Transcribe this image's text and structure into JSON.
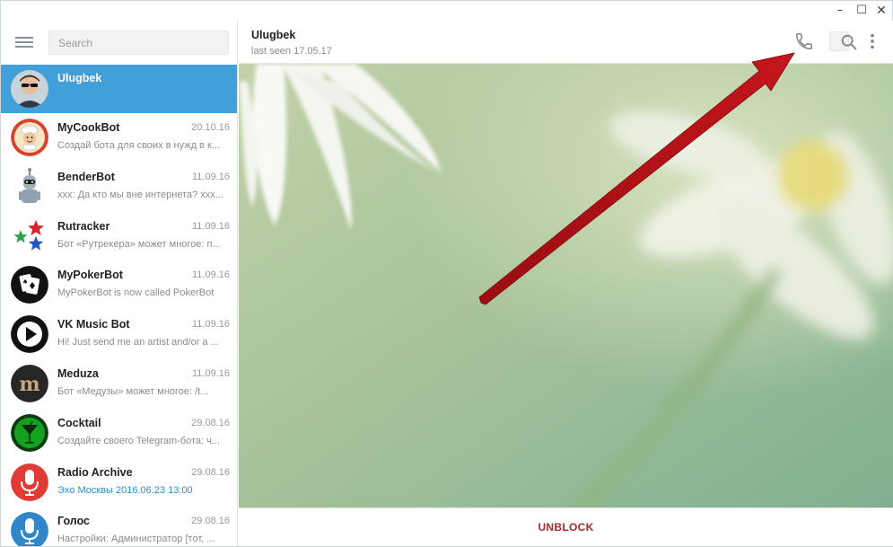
{
  "window": {
    "controls": {
      "minimize": "–",
      "maximize": "☐",
      "close": "✕"
    }
  },
  "sidebar": {
    "menu_icon": "hamburger-menu-icon",
    "search_placeholder": "Search",
    "chats": [
      {
        "name": "Ulugbek",
        "date": "",
        "preview": "",
        "active": true,
        "avatar": "user-photo"
      },
      {
        "name": "MyCookBot",
        "date": "20.10.16",
        "preview": "Создай бота для своих в нужд в к...",
        "avatar": "cook-bot-logo"
      },
      {
        "name": "BenderBot",
        "date": "11.09.16",
        "preview": "xxx: Да кто мы вне интернета? xxx...",
        "avatar": "bender-robot-logo"
      },
      {
        "name": "Rutracker",
        "date": "11.09.16",
        "preview": "Бот «Рутрекера» может многое: п...",
        "avatar": "rutracker-stars-logo"
      },
      {
        "name": "MyPokerBot",
        "date": "11.09.16",
        "preview": "MyPokerBot is now called PokerBot",
        "avatar": "poker-cards-logo"
      },
      {
        "name": "VK Music Bot",
        "date": "11.09.16",
        "preview": "Hi! Just send me an artist and/or a ...",
        "avatar": "play-button-logo"
      },
      {
        "name": "Meduza",
        "date": "11.09.16",
        "preview": "Бот «Медузы» может многое:  /t...",
        "avatar": "meduza-m-logo"
      },
      {
        "name": "Cocktail",
        "date": "29.08.16",
        "preview": "Создайте своего Telegram-бота: ч...",
        "avatar": "cocktail-glass-logo"
      },
      {
        "name": "Radio Archive",
        "date": "29.08.16",
        "preview": "Эхо Москвы 2016.06.23 13:00",
        "accent": true,
        "avatar": "microphone-logo"
      },
      {
        "name": "Голос",
        "date": "29.08.16",
        "preview": "Настройки: Администратор [тот, ...",
        "avatar": "microphone-blue-logo"
      }
    ]
  },
  "header": {
    "peer_name": "Ulugbek",
    "peer_status": "last seen 17.05.17",
    "icons": [
      "phone-call-icon",
      "search-icon",
      "more-vertical-icon"
    ]
  },
  "chat_area": {
    "background": "daisy-flowers-wallpaper",
    "annotation": "red-arrow-pointing-to-call-icon"
  },
  "bottom_bar": {
    "unblock_label": "UNBLOCK"
  },
  "colors": {
    "accent": "#419fd9",
    "unblock": "#a52a2a",
    "arrow": "#b11217",
    "preview_accent": "#2a8fcf"
  }
}
